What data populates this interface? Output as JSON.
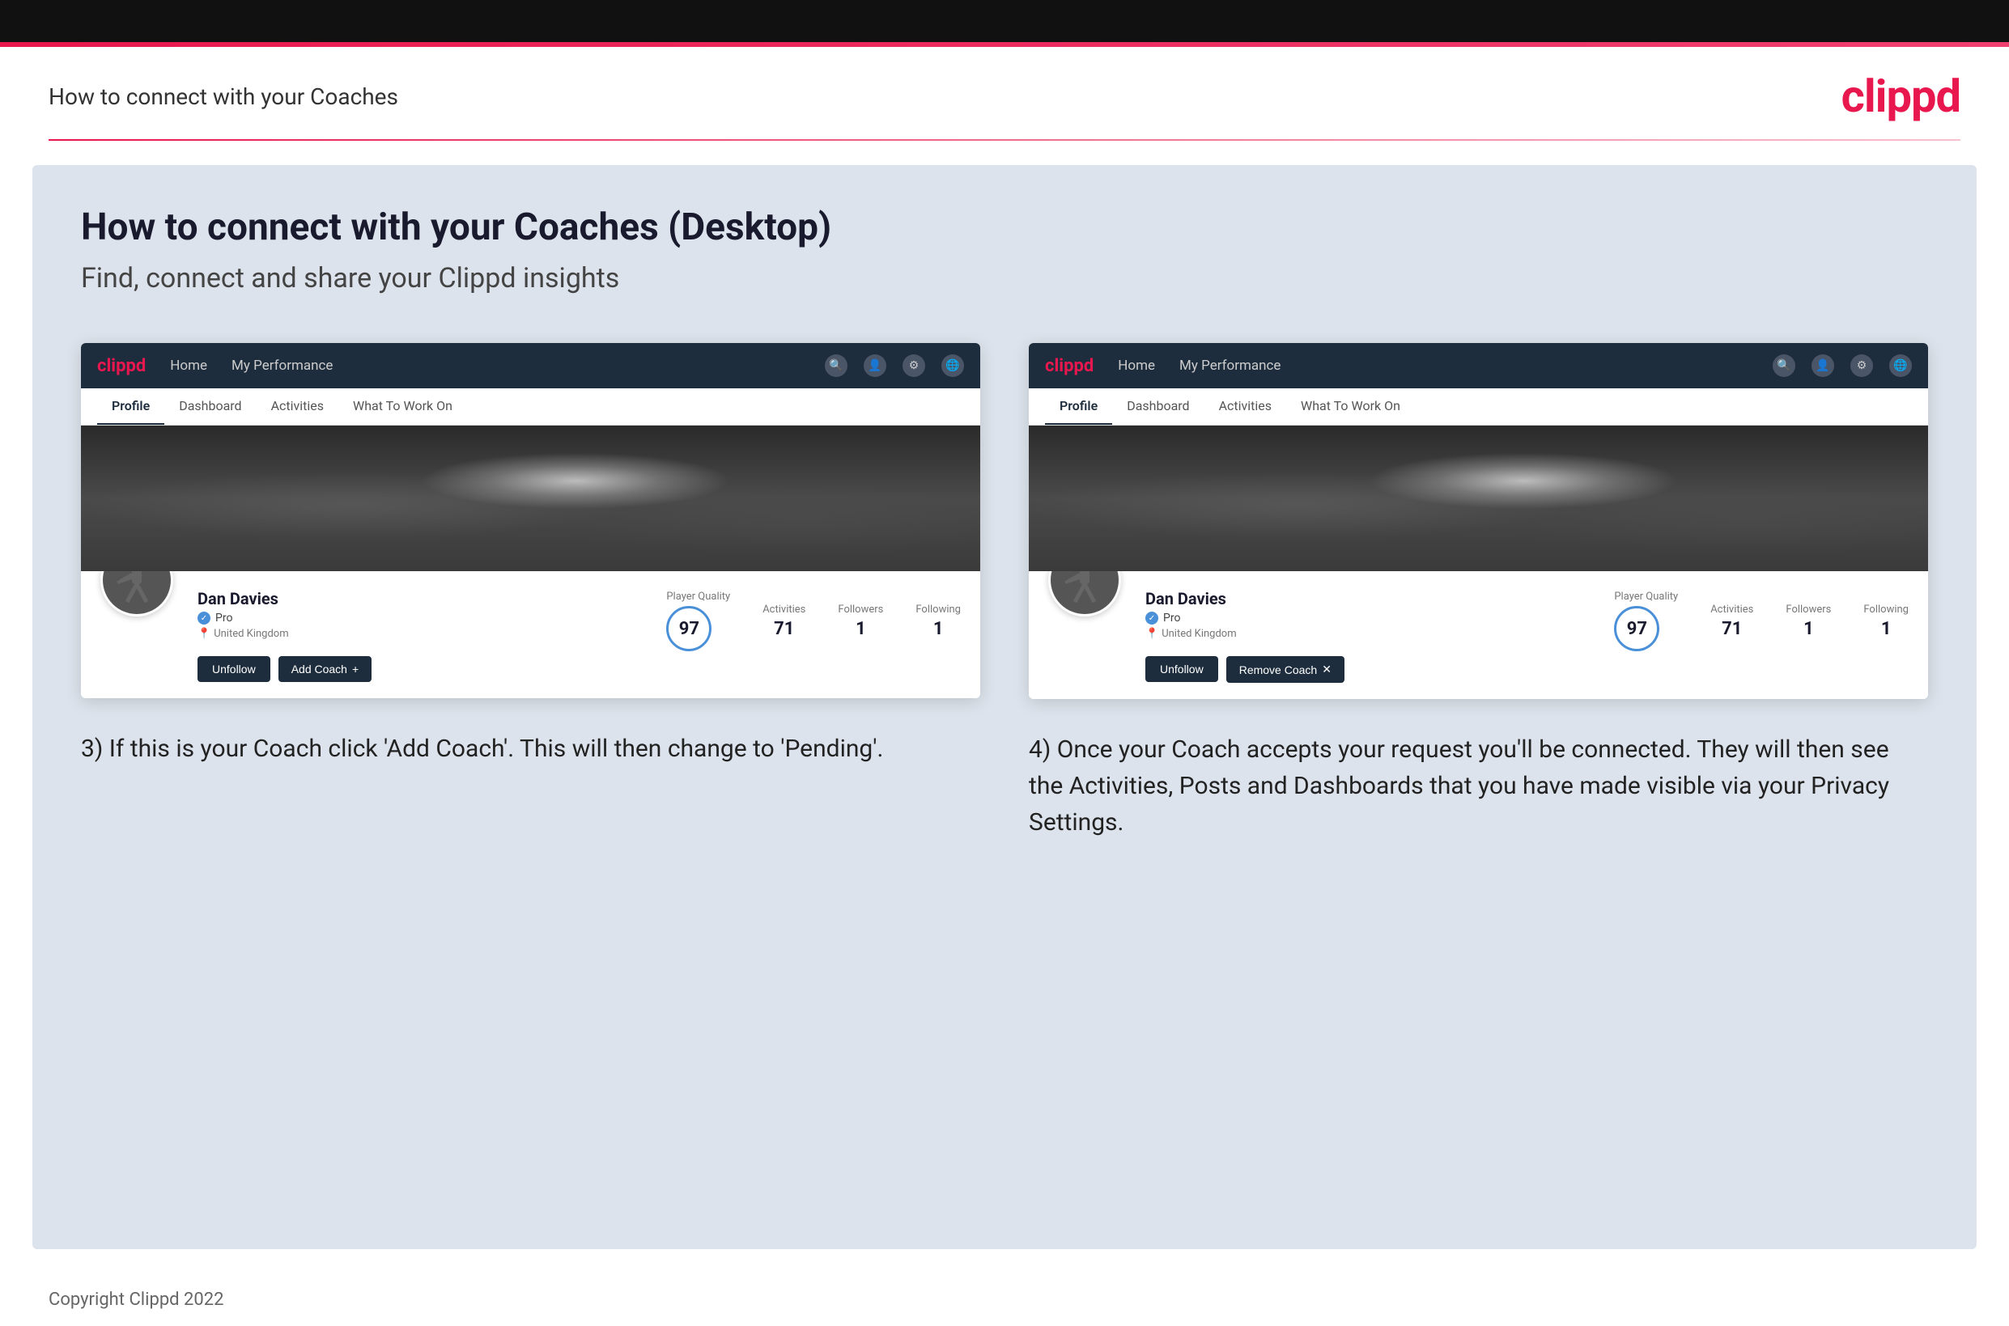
{
  "topBar": {},
  "accentBar": {},
  "header": {
    "title": "How to connect with your Coaches",
    "logo": "clippd"
  },
  "main": {
    "heading": "How to connect with your Coaches (Desktop)",
    "subheading": "Find, connect and share your Clippd insights",
    "leftPanel": {
      "screenshot": {
        "navbar": {
          "logo": "clippd",
          "navItems": [
            "Home",
            "My Performance"
          ],
          "icons": [
            "search",
            "person",
            "settings",
            "avatar"
          ]
        },
        "tabs": [
          "Profile",
          "Dashboard",
          "Activities",
          "What To Work On"
        ],
        "activeTab": "Profile",
        "user": {
          "name": "Dan Davies",
          "badge": "Pro",
          "location": "United Kingdom",
          "playerQuality": "97",
          "activities": "71",
          "followers": "1",
          "following": "1"
        },
        "buttons": {
          "unfollow": "Unfollow",
          "addCoach": "Add Coach"
        }
      },
      "description": "3) If this is your Coach click 'Add Coach'. This will then change to 'Pending'."
    },
    "rightPanel": {
      "screenshot": {
        "navbar": {
          "logo": "clippd",
          "navItems": [
            "Home",
            "My Performance"
          ],
          "icons": [
            "search",
            "person",
            "settings",
            "avatar"
          ]
        },
        "tabs": [
          "Profile",
          "Dashboard",
          "Activities",
          "What To Work On"
        ],
        "activeTab": "Profile",
        "user": {
          "name": "Dan Davies",
          "badge": "Pro",
          "location": "United Kingdom",
          "playerQuality": "97",
          "activities": "71",
          "followers": "1",
          "following": "1"
        },
        "buttons": {
          "unfollow": "Unfollow",
          "removeCoach": "Remove Coach"
        }
      },
      "description": "4) Once your Coach accepts your request you'll be connected. They will then see the Activities, Posts and Dashboards that you have made visible via your Privacy Settings."
    }
  },
  "footer": {
    "copyright": "Copyright Clippd 2022"
  },
  "labels": {
    "playerQuality": "Player Quality",
    "activities": "Activities",
    "followers": "Followers",
    "following": "Following"
  }
}
